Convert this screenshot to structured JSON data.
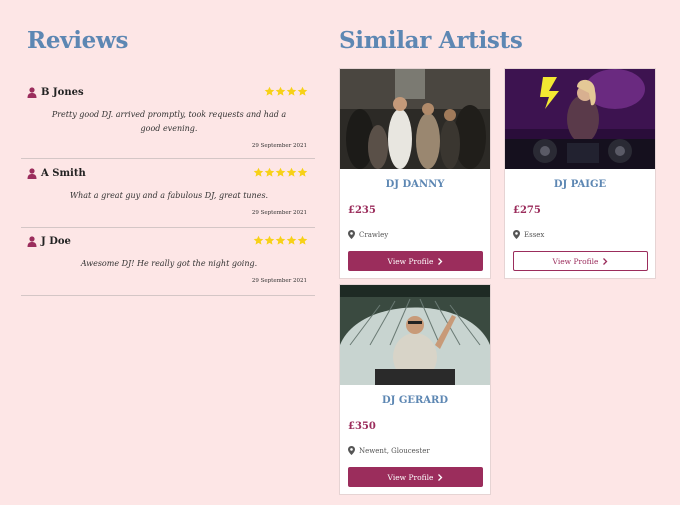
{
  "reviews": {
    "title": "Reviews",
    "items": [
      {
        "name": "B Jones",
        "stars": 4,
        "text": "Pretty good DJ. arrived promptly, took requests and had a good evening.",
        "date": "29 September 2021"
      },
      {
        "name": "A Smith",
        "stars": 5,
        "text": "What a great guy and a fabulous DJ, great tunes.",
        "date": "29 September 2021"
      },
      {
        "name": "J Doe",
        "stars": 5,
        "text": "Awesome DJ! He really got the night going.",
        "date": "29 September 2021"
      }
    ]
  },
  "similar": {
    "title": "Similar Artists",
    "artists": [
      {
        "name": "DJ DANNY",
        "price": "£235",
        "location": "Crawley",
        "button": "View Profile"
      },
      {
        "name": "DJ PAIGE",
        "price": "£275",
        "location": "Essex",
        "button": "View Profile"
      },
      {
        "name": "DJ GERARD",
        "price": "£350",
        "location": "Newent, Gloucester",
        "button": "View Profile"
      }
    ]
  },
  "colors": {
    "background": "#fde6e6",
    "heading": "#5d87b3",
    "accent": "#9b2d5c",
    "star": "#f7d117"
  },
  "icons": {
    "user": "user-icon",
    "star": "star-icon",
    "pin": "map-pin-icon",
    "chevron": "chevron-right-icon"
  }
}
